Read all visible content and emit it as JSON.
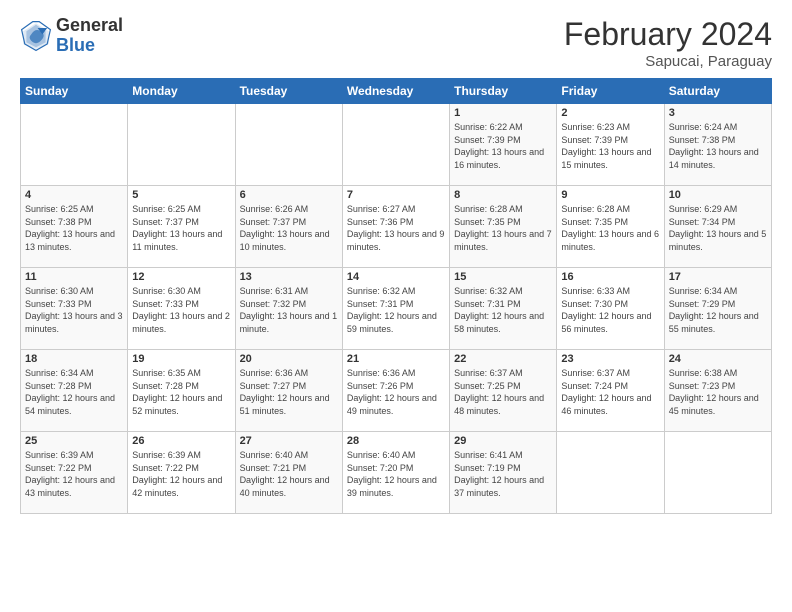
{
  "header": {
    "logo_general": "General",
    "logo_blue": "Blue",
    "title": "February 2024",
    "subtitle": "Sapucai, Paraguay"
  },
  "days_of_week": [
    "Sunday",
    "Monday",
    "Tuesday",
    "Wednesday",
    "Thursday",
    "Friday",
    "Saturday"
  ],
  "weeks": [
    [
      {
        "num": "",
        "info": ""
      },
      {
        "num": "",
        "info": ""
      },
      {
        "num": "",
        "info": ""
      },
      {
        "num": "",
        "info": ""
      },
      {
        "num": "1",
        "info": "Sunrise: 6:22 AM\nSunset: 7:39 PM\nDaylight: 13 hours and 16 minutes."
      },
      {
        "num": "2",
        "info": "Sunrise: 6:23 AM\nSunset: 7:39 PM\nDaylight: 13 hours and 15 minutes."
      },
      {
        "num": "3",
        "info": "Sunrise: 6:24 AM\nSunset: 7:38 PM\nDaylight: 13 hours and 14 minutes."
      }
    ],
    [
      {
        "num": "4",
        "info": "Sunrise: 6:25 AM\nSunset: 7:38 PM\nDaylight: 13 hours and 13 minutes."
      },
      {
        "num": "5",
        "info": "Sunrise: 6:25 AM\nSunset: 7:37 PM\nDaylight: 13 hours and 11 minutes."
      },
      {
        "num": "6",
        "info": "Sunrise: 6:26 AM\nSunset: 7:37 PM\nDaylight: 13 hours and 10 minutes."
      },
      {
        "num": "7",
        "info": "Sunrise: 6:27 AM\nSunset: 7:36 PM\nDaylight: 13 hours and 9 minutes."
      },
      {
        "num": "8",
        "info": "Sunrise: 6:28 AM\nSunset: 7:35 PM\nDaylight: 13 hours and 7 minutes."
      },
      {
        "num": "9",
        "info": "Sunrise: 6:28 AM\nSunset: 7:35 PM\nDaylight: 13 hours and 6 minutes."
      },
      {
        "num": "10",
        "info": "Sunrise: 6:29 AM\nSunset: 7:34 PM\nDaylight: 13 hours and 5 minutes."
      }
    ],
    [
      {
        "num": "11",
        "info": "Sunrise: 6:30 AM\nSunset: 7:33 PM\nDaylight: 13 hours and 3 minutes."
      },
      {
        "num": "12",
        "info": "Sunrise: 6:30 AM\nSunset: 7:33 PM\nDaylight: 13 hours and 2 minutes."
      },
      {
        "num": "13",
        "info": "Sunrise: 6:31 AM\nSunset: 7:32 PM\nDaylight: 13 hours and 1 minute."
      },
      {
        "num": "14",
        "info": "Sunrise: 6:32 AM\nSunset: 7:31 PM\nDaylight: 12 hours and 59 minutes."
      },
      {
        "num": "15",
        "info": "Sunrise: 6:32 AM\nSunset: 7:31 PM\nDaylight: 12 hours and 58 minutes."
      },
      {
        "num": "16",
        "info": "Sunrise: 6:33 AM\nSunset: 7:30 PM\nDaylight: 12 hours and 56 minutes."
      },
      {
        "num": "17",
        "info": "Sunrise: 6:34 AM\nSunset: 7:29 PM\nDaylight: 12 hours and 55 minutes."
      }
    ],
    [
      {
        "num": "18",
        "info": "Sunrise: 6:34 AM\nSunset: 7:28 PM\nDaylight: 12 hours and 54 minutes."
      },
      {
        "num": "19",
        "info": "Sunrise: 6:35 AM\nSunset: 7:28 PM\nDaylight: 12 hours and 52 minutes."
      },
      {
        "num": "20",
        "info": "Sunrise: 6:36 AM\nSunset: 7:27 PM\nDaylight: 12 hours and 51 minutes."
      },
      {
        "num": "21",
        "info": "Sunrise: 6:36 AM\nSunset: 7:26 PM\nDaylight: 12 hours and 49 minutes."
      },
      {
        "num": "22",
        "info": "Sunrise: 6:37 AM\nSunset: 7:25 PM\nDaylight: 12 hours and 48 minutes."
      },
      {
        "num": "23",
        "info": "Sunrise: 6:37 AM\nSunset: 7:24 PM\nDaylight: 12 hours and 46 minutes."
      },
      {
        "num": "24",
        "info": "Sunrise: 6:38 AM\nSunset: 7:23 PM\nDaylight: 12 hours and 45 minutes."
      }
    ],
    [
      {
        "num": "25",
        "info": "Sunrise: 6:39 AM\nSunset: 7:22 PM\nDaylight: 12 hours and 43 minutes."
      },
      {
        "num": "26",
        "info": "Sunrise: 6:39 AM\nSunset: 7:22 PM\nDaylight: 12 hours and 42 minutes."
      },
      {
        "num": "27",
        "info": "Sunrise: 6:40 AM\nSunset: 7:21 PM\nDaylight: 12 hours and 40 minutes."
      },
      {
        "num": "28",
        "info": "Sunrise: 6:40 AM\nSunset: 7:20 PM\nDaylight: 12 hours and 39 minutes."
      },
      {
        "num": "29",
        "info": "Sunrise: 6:41 AM\nSunset: 7:19 PM\nDaylight: 12 hours and 37 minutes."
      },
      {
        "num": "",
        "info": ""
      },
      {
        "num": "",
        "info": ""
      }
    ]
  ]
}
